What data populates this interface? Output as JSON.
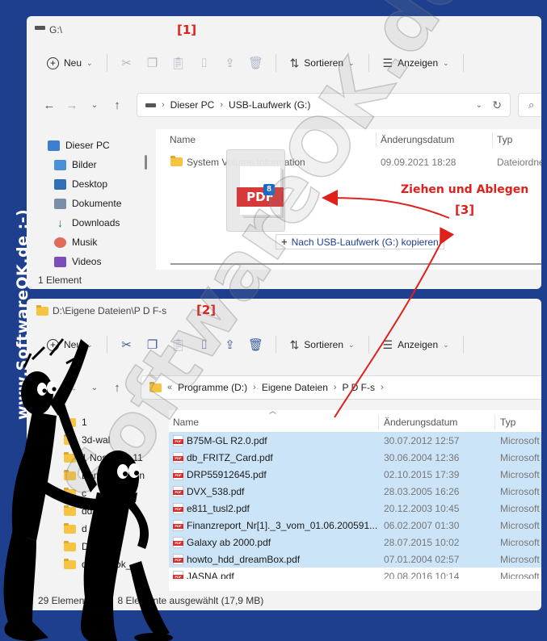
{
  "side_text": "www.SoftwareOK.de :-)",
  "watermark": "SoftwareOK.de",
  "colors": {
    "brand_blue": "#1e3f8e",
    "annotation_red": "#e0201a",
    "selection": "#cce4f7"
  },
  "window1": {
    "title": "G:\\",
    "label": "[1]",
    "toolbar": {
      "new": "Neu",
      "sort": "Sortieren",
      "view": "Anzeigen"
    },
    "breadcrumb": [
      "Dieser PC",
      "USB-Laufwerk (G:)"
    ],
    "nav": [
      {
        "label": "Dieser PC",
        "icon": "pc-icon"
      },
      {
        "label": "Bilder",
        "icon": "pictures-icon"
      },
      {
        "label": "Desktop",
        "icon": "desktop-icon"
      },
      {
        "label": "Dokumente",
        "icon": "documents-icon"
      },
      {
        "label": "Downloads",
        "icon": "downloads-icon"
      },
      {
        "label": "Musik",
        "icon": "music-icon"
      },
      {
        "label": "Videos",
        "icon": "videos-icon"
      }
    ],
    "columns": {
      "name": "Name",
      "date": "Änderungsdatum",
      "type": "Typ"
    },
    "files": [
      {
        "name": "System Volume Information",
        "date": "09.09.2021 18:28",
        "type": "Dateiordner"
      }
    ],
    "status": "1 Element",
    "drag_tip": "Nach USB-Laufwerk (G:) kopieren",
    "drag_badge": "8",
    "drag_doc_label": "PDF"
  },
  "annotation": {
    "text": "Ziehen und Ablegen",
    "label": "[3]"
  },
  "window2": {
    "title": "D:\\Eigene Dateien\\P D F-s",
    "label": "[2]",
    "toolbar": {
      "new": "Neu",
      "sort": "Sortieren",
      "view": "Anzeigen"
    },
    "breadcrumb": [
      "Programme (D:)",
      "Eigene Dateien",
      "P D F-s"
    ],
    "nav": [
      "1",
      "3d-wal",
      "1 Nostalgie 11",
      "Benutzerdaten",
      "c",
      "dd",
      "d",
      "Des",
      "desktopok_"
    ],
    "columns": {
      "name": "Name",
      "date": "Änderungsdatum",
      "type": "Typ"
    },
    "files": [
      {
        "name": "B75M-GL R2.0.pdf",
        "date": "30.07.2012 12:57",
        "type": "Microsoft",
        "selected": true
      },
      {
        "name": "db_FRITZ_Card.pdf",
        "date": "30.06.2004 12:36",
        "type": "Microsoft",
        "selected": true
      },
      {
        "name": "DRP55912645.pdf",
        "date": "02.10.2015 17:39",
        "type": "Microsoft",
        "selected": true
      },
      {
        "name": "DVX_538.pdf",
        "date": "28.03.2005 16:26",
        "type": "Microsoft",
        "selected": true
      },
      {
        "name": "e811_tusl2.pdf",
        "date": "20.12.2003 10:45",
        "type": "Microsoft",
        "selected": true
      },
      {
        "name": "Finanzreport_Nr[1]._3_vom_01.06.200591...",
        "date": "06.02.2007 01:30",
        "type": "Microsoft",
        "selected": true
      },
      {
        "name": "Galaxy ab 2000.pdf",
        "date": "28.07.2015 10:02",
        "type": "Microsoft",
        "selected": true
      },
      {
        "name": "howto_hdd_dreamBox.pdf",
        "date": "07.01.2004 02:57",
        "type": "Microsoft",
        "selected": true
      },
      {
        "name": "JASNA.pdf",
        "date": "20.08.2016 10:14",
        "type": "Microsoft",
        "selected": false
      }
    ],
    "status_count": "29 Elemente",
    "status_selected": "8 Elemente ausgewählt (17,9 MB)"
  }
}
